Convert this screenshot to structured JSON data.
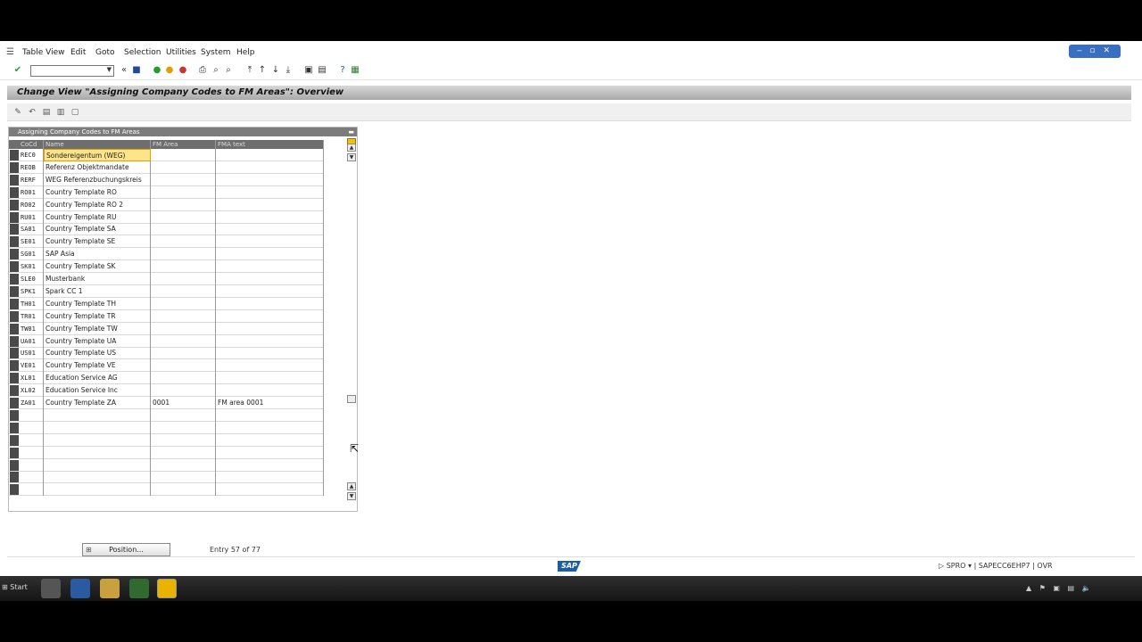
{
  "menu": [
    "Table View",
    "Edit",
    "Goto",
    "Selection",
    "Utilities",
    "System",
    "Help"
  ],
  "toolbar": {
    "command_field_value": "",
    "icons": [
      "enter-icon",
      "save-icon",
      "back-icon",
      "exit-icon",
      "cancel-icon",
      "print-icon",
      "find-icon",
      "find-next-icon",
      "first-page-icon",
      "previous-page-icon",
      "next-page-icon",
      "last-page-icon",
      "create-session-icon",
      "shortcut-icon",
      "help-icon",
      "customize-layout-icon"
    ]
  },
  "title": "Change View \"Assigning Company Codes to FM Areas\": Overview",
  "table": {
    "caption": "Assigning Company Codes to FM Areas",
    "columns": [
      "CoCd",
      "Name",
      "FM Area",
      "FMA text"
    ],
    "rows": [
      {
        "cocd": "REC0",
        "name": "Sondereigentum (WEG)",
        "fm_area": "",
        "fma_text": ""
      },
      {
        "cocd": "REOB",
        "name": "Referenz Objektmandate",
        "fm_area": "",
        "fma_text": ""
      },
      {
        "cocd": "RERF",
        "name": "WEG Referenzbuchungskreis",
        "fm_area": "",
        "fma_text": ""
      },
      {
        "cocd": "RO01",
        "name": "Country Template RO",
        "fm_area": "",
        "fma_text": ""
      },
      {
        "cocd": "RO02",
        "name": "Country Template RO 2",
        "fm_area": "",
        "fma_text": ""
      },
      {
        "cocd": "RU01",
        "name": "Country Template RU",
        "fm_area": "",
        "fma_text": ""
      },
      {
        "cocd": "SA01",
        "name": "Country Template SA",
        "fm_area": "",
        "fma_text": ""
      },
      {
        "cocd": "SE01",
        "name": "Country Template SE",
        "fm_area": "",
        "fma_text": ""
      },
      {
        "cocd": "SG01",
        "name": "SAP Asia",
        "fm_area": "",
        "fma_text": ""
      },
      {
        "cocd": "SK01",
        "name": "Country Template SK",
        "fm_area": "",
        "fma_text": ""
      },
      {
        "cocd": "SLE0",
        "name": "Musterbank",
        "fm_area": "",
        "fma_text": ""
      },
      {
        "cocd": "SPK1",
        "name": "Spark CC 1",
        "fm_area": "",
        "fma_text": ""
      },
      {
        "cocd": "TH01",
        "name": "Country Template TH",
        "fm_area": "",
        "fma_text": ""
      },
      {
        "cocd": "TR01",
        "name": "Country Template TR",
        "fm_area": "",
        "fma_text": ""
      },
      {
        "cocd": "TW01",
        "name": "Country Template TW",
        "fm_area": "",
        "fma_text": ""
      },
      {
        "cocd": "UA01",
        "name": "Country Template UA",
        "fm_area": "",
        "fma_text": ""
      },
      {
        "cocd": "US01",
        "name": "Country Template US",
        "fm_area": "",
        "fma_text": ""
      },
      {
        "cocd": "VE01",
        "name": "Country Template VE",
        "fm_area": "",
        "fma_text": ""
      },
      {
        "cocd": "XL01",
        "name": "Education Service AG",
        "fm_area": "",
        "fma_text": ""
      },
      {
        "cocd": "XL02",
        "name": "Education Service Inc",
        "fm_area": "",
        "fma_text": ""
      },
      {
        "cocd": "ZA01",
        "name": "Country Template ZA",
        "fm_area": "0001",
        "fma_text": "FM area 0001"
      }
    ],
    "empty_rows": 7
  },
  "position_button": "Position...",
  "entry_info": "Entry 57 of 77",
  "status": {
    "logo": "SAP",
    "system_info": "SPRO ▾ | SAPECC6EHP7 | OVR"
  },
  "taskbar": {
    "start": "Start"
  },
  "colors": {
    "title_bg": "#b0b0b0",
    "highlight": "#ffe48a",
    "header_bg": "#6e6e6e"
  }
}
